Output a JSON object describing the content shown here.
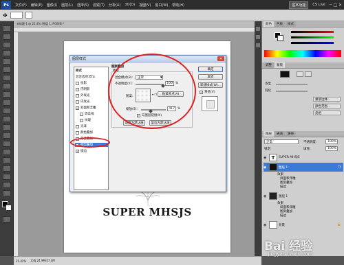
{
  "app": {
    "logo": "Ps",
    "menu": [
      "文件(F)",
      "编辑(E)",
      "图像(I)",
      "图层(L)",
      "选择(S)",
      "滤镜(T)",
      "分析(A)",
      "3D(D)",
      "视图(V)",
      "窗口(W)",
      "帮助(H)"
    ],
    "workspace_label": "基本功能",
    "cslive": "CS Live"
  },
  "document": {
    "tab_title": "未标题-1 @ 21.4% (图层 1, RGB/8) *",
    "zoom": "21.42%",
    "doc_info": "文档:24.9M/47.3M",
    "canvas_text": "SUPER MHSJS"
  },
  "dialog": {
    "title": "图层样式",
    "close": "✕",
    "styles": [
      {
        "label": "样式",
        "checked": null
      },
      {
        "label": "混合选项:默认",
        "checked": null
      },
      {
        "label": "投影",
        "checked": false
      },
      {
        "label": "内阴影",
        "checked": false
      },
      {
        "label": "外发光",
        "checked": false
      },
      {
        "label": "内发光",
        "checked": false
      },
      {
        "label": "斜面和浮雕",
        "checked": true
      },
      {
        "label": "等高线",
        "checked": false
      },
      {
        "label": "纹理",
        "checked": false
      },
      {
        "label": "光泽",
        "checked": false
      },
      {
        "label": "颜色叠加",
        "checked": false
      },
      {
        "label": "渐变叠加",
        "checked": false
      },
      {
        "label": "图案叠加",
        "checked": true
      },
      {
        "label": "描边",
        "checked": true
      }
    ],
    "section_title": "图案叠加",
    "group_title": "图案",
    "blend_mode_label": "混合模式(B):",
    "blend_mode_value": "正常",
    "opacity_label": "不透明度(Y):",
    "opacity_value": "100",
    "opacity_unit": "%",
    "pattern_label": "图案:",
    "snap_origin_button": "贴紧原点(A)",
    "scale_label": "缩放(S):",
    "scale_value": "417",
    "scale_unit": "%",
    "link_with_layer": "与图层链接(K)",
    "make_default": "设置为默认值",
    "reset_default": "复位为默认值",
    "ok": "确定",
    "cancel": "取消",
    "new_style": "新建样式(W)...",
    "preview": "预览(V)"
  },
  "right_panel": {
    "color_tabs": [
      "颜色",
      "色板",
      "样式"
    ],
    "adjust_tabs": [
      "调整",
      "蒙版"
    ],
    "adjust_buttons": [
      "图层蒙版",
      "矢量蒙版",
      "浓度",
      "羽化",
      "蒙版边缘...",
      "颜色范围...",
      "反相"
    ],
    "layer_tabs": [
      "图层",
      "通道",
      "路径"
    ],
    "blend_mode": "正常",
    "opacity_label": "不透明度:",
    "opacity_value": "100%",
    "fill_label": "填充:",
    "fill_value": "100%",
    "lock_label": "锁定:",
    "layers": [
      {
        "name": "SUPER MHSJS",
        "type": "text"
      },
      {
        "name": "图层 1",
        "type": "pattern",
        "selected": true,
        "fx": "fx"
      },
      {
        "name": "效果",
        "type": "effect-header"
      },
      {
        "name": "斜面和浮雕",
        "type": "effect"
      },
      {
        "name": "图案叠加",
        "type": "effect"
      },
      {
        "name": "描边",
        "type": "effect"
      },
      {
        "name": "图层 1",
        "type": "normal"
      },
      {
        "name": "效果",
        "type": "effect-header"
      },
      {
        "name": "斜面和浮雕",
        "type": "effect"
      },
      {
        "name": "图案叠加",
        "type": "effect"
      },
      {
        "name": "描边",
        "type": "effect"
      },
      {
        "name": "背景",
        "type": "background"
      }
    ]
  },
  "watermark": {
    "brand": "Bai 经验",
    "url": "jingyan.baidu.com"
  },
  "colors": {
    "accent": "#3a7bd5",
    "annotation": "#e02020"
  }
}
